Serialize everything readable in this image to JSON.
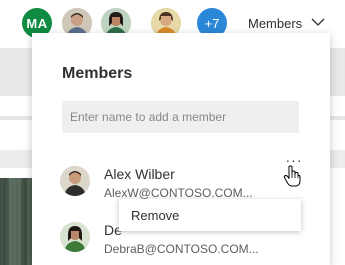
{
  "header": {
    "avatars": [
      {
        "initials": "MA",
        "color": "#108b42"
      },
      {
        "icon": "person-photo-icon"
      },
      {
        "icon": "person-photo-icon"
      },
      {
        "icon": "person-photo-icon"
      }
    ],
    "more_count": "+7",
    "members_label": "Members"
  },
  "panel": {
    "title": "Members",
    "add_member_placeholder": "Enter name to add a member",
    "members": [
      {
        "name": "Alex Wilber",
        "email": "AlexW@CONTOSO.COM..."
      },
      {
        "name": "De",
        "email": "DebraB@CONTOSO.COM..."
      }
    ],
    "more_button_label": "···",
    "context_menu": {
      "remove_label": "Remove"
    }
  }
}
